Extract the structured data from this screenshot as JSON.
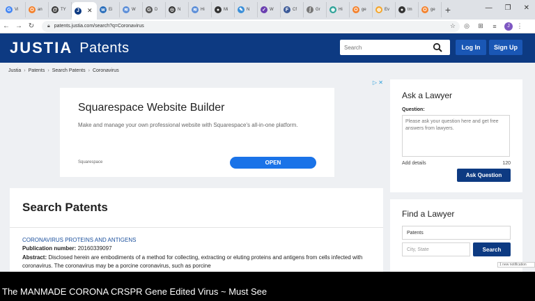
{
  "browser": {
    "tabs": [
      {
        "label": "Vi",
        "icon": "google-icon",
        "color": "#4285f4",
        "glyph": "G"
      },
      {
        "label": "an",
        "icon": "site-icon",
        "color": "#f4812c",
        "glyph": "O"
      },
      {
        "label": "TY",
        "icon": "site-icon",
        "color": "#333333",
        "glyph": "@"
      },
      {
        "label": "",
        "icon": "justia-icon",
        "color": "#0d3a82",
        "glyph": "J",
        "active": true
      },
      {
        "label": "Ei",
        "icon": "site-icon",
        "color": "#2a6ebb",
        "glyph": "w"
      },
      {
        "label": "W",
        "icon": "site-icon",
        "color": "#5a8dd8",
        "glyph": "≋"
      },
      {
        "label": "D",
        "icon": "google-icon",
        "color": "#555555",
        "glyph": "G"
      },
      {
        "label": "N",
        "icon": "site-icon",
        "color": "#333333",
        "glyph": "◎"
      },
      {
        "label": "Hi",
        "icon": "site-icon",
        "color": "#5a8dd8",
        "glyph": "≋"
      },
      {
        "label": "Mi",
        "icon": "site-icon",
        "color": "#333333",
        "glyph": "●"
      },
      {
        "label": "N",
        "icon": "site-icon",
        "color": "#3a8fd9",
        "glyph": "✎"
      },
      {
        "label": "W",
        "icon": "site-icon",
        "color": "#6a3fb0",
        "glyph": "✓"
      },
      {
        "label": "Cf",
        "icon": "facebook-icon",
        "color": "#3b5998",
        "glyph": "F"
      },
      {
        "label": "Gr",
        "icon": "site-icon",
        "color": "#777777",
        "glyph": "ʃ"
      },
      {
        "label": "Hi",
        "icon": "site-icon",
        "color": "#2aa197",
        "glyph": "◉"
      },
      {
        "label": "ge",
        "icon": "site-icon",
        "color": "#f4812c",
        "glyph": "O"
      },
      {
        "label": "Ev",
        "icon": "site-icon",
        "color": "#f4a62c",
        "glyph": "◍"
      },
      {
        "label": "tm",
        "icon": "site-icon",
        "color": "#333333",
        "glyph": "●"
      },
      {
        "label": "ge",
        "icon": "site-icon",
        "color": "#f4812c",
        "glyph": "O"
      }
    ],
    "url": "patents.justia.com/search?q=Coronavirus",
    "profile_initial": "J"
  },
  "header": {
    "brand": "JUSTIA",
    "product": "Patents",
    "search_placeholder": "Search",
    "login_label": "Log In",
    "signup_label": "Sign Up",
    "color": "#0d3a82"
  },
  "breadcrumb": [
    "Justia",
    "Patents",
    "Search Patents",
    "Coronavirus"
  ],
  "ad": {
    "title": "Squarespace Website Builder",
    "description": "Make and manage your own professional website with Squarespace's all-in-one platform.",
    "source": "Squarespace",
    "cta": "OPEN",
    "choices_glyph": "▷ ✕"
  },
  "search": {
    "heading": "Search Patents",
    "result": {
      "title": "CORONAVIRUS PROTEINS AND ANTIGENS",
      "pub_label": "Publication number:",
      "pub_number": "20160339097",
      "abstract_label": "Abstract:",
      "abstract": "Disclosed herein are embodiments of a method for collecting, extracting or eluting proteins and antigens from cells infected with coronavirus. The coronavirus may be a porcine coronavirus, such as porcine"
    }
  },
  "ask_lawyer": {
    "heading": "Ask a Lawyer",
    "question_label": "Question:",
    "question_placeholder": "Please ask your question here and get free answers from lawyers.",
    "add_details": "Add details",
    "char_count": "120",
    "button": "Ask Question"
  },
  "find_lawyer": {
    "heading": "Find a Lawyer",
    "practice_value": "Patents",
    "location_placeholder": "City, State",
    "button": "Search"
  },
  "notification": "1 new notification",
  "video_title": "The MANMADE CORONA CRSPR Gene Edited Virus ~ Must See"
}
